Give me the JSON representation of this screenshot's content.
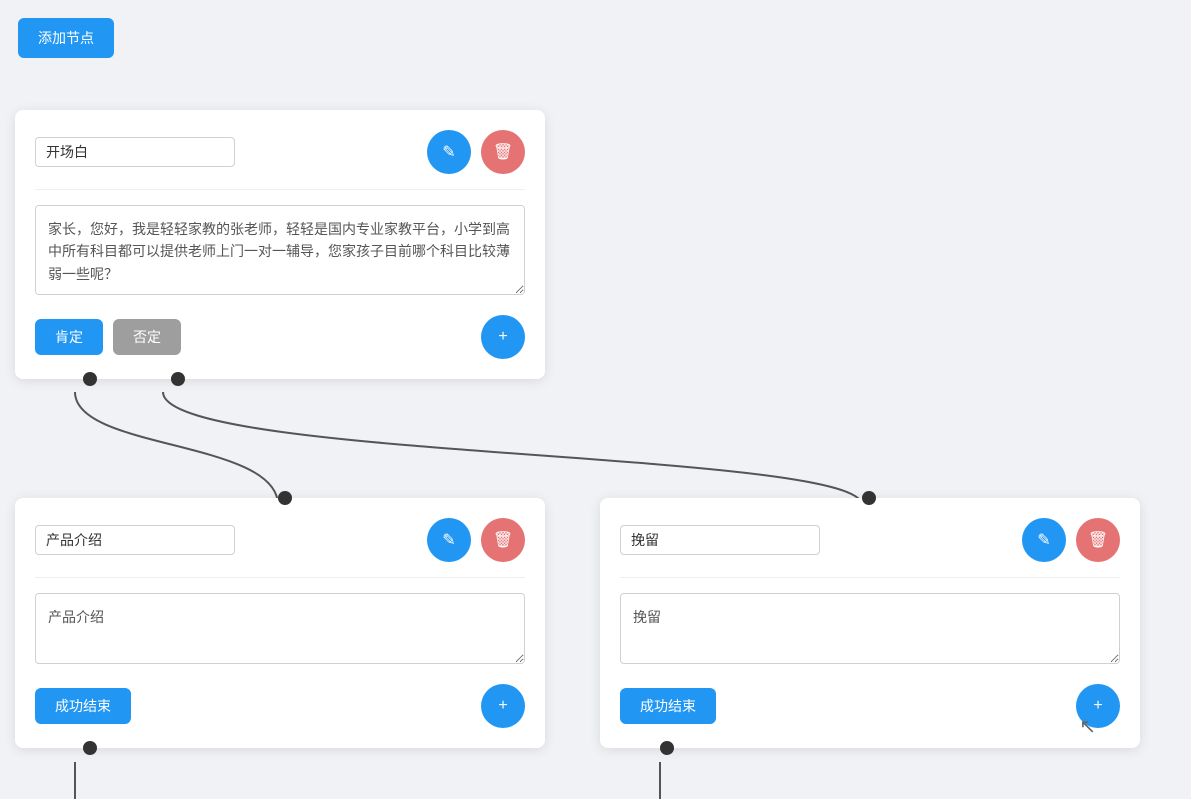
{
  "toolbar": {
    "add_node_label": "添加节点"
  },
  "cards": {
    "top": {
      "title": "开场白",
      "content": "家长，您好，我是轻轻家教的张老师，轻轻是国内专业家教平台，小学到高中所有科目都可以提供老师上门一对一辅导，您家孩子目前哪个科目比较薄弱一些呢？",
      "affirm_label": "肯定",
      "negate_label": "否定"
    },
    "left": {
      "title": "产品介绍",
      "content": "产品介绍",
      "success_label": "成功结束"
    },
    "right": {
      "title": "挽留",
      "content": "挽留",
      "success_label": "成功结束"
    }
  },
  "icons": {
    "edit": "✎",
    "delete": "🗑",
    "add": "+"
  }
}
